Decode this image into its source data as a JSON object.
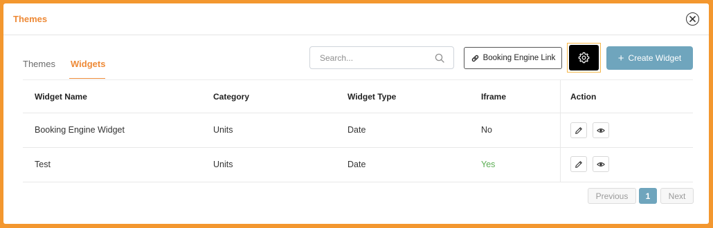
{
  "modal": {
    "title": "Themes"
  },
  "tabs": [
    {
      "label": "Themes",
      "active": false
    },
    {
      "label": "Widgets",
      "active": true
    }
  ],
  "search": {
    "placeholder": "Search...",
    "value": ""
  },
  "toolbar": {
    "booking_link_label": "Booking Engine Link",
    "create_label": "Create Widget",
    "create_icon": "+"
  },
  "table": {
    "headers": [
      "Widget Name",
      "Category",
      "Widget Type",
      "Iframe",
      "Action"
    ],
    "rows": [
      {
        "name": "Booking Engine Widget",
        "category": "Units",
        "type": "Date",
        "iframe": "No"
      },
      {
        "name": "Test",
        "category": "Units",
        "type": "Date",
        "iframe": "Yes"
      }
    ]
  },
  "pagination": {
    "previous": "Previous",
    "current": "1",
    "next": "Next"
  },
  "colors": {
    "accent": "#ee8a37",
    "border": "#f3972f",
    "primary_button": "#6fa5bd",
    "iframe_yes": "#5cae54"
  },
  "icons": [
    "close-icon",
    "search-icon",
    "link-icon",
    "settings-icon",
    "plus-icon",
    "edit-icon",
    "eye-icon"
  ]
}
